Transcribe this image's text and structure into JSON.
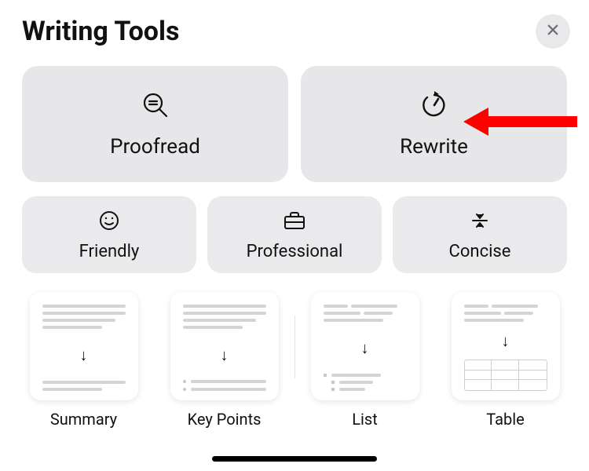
{
  "header": {
    "title": "Writing Tools"
  },
  "primary": [
    {
      "id": "proofread",
      "label": "Proofread",
      "icon": "magnify-equal-icon"
    },
    {
      "id": "rewrite",
      "label": "Rewrite",
      "icon": "rewrite-cycle-icon"
    }
  ],
  "secondary": [
    {
      "id": "friendly",
      "label": "Friendly",
      "icon": "smile-icon"
    },
    {
      "id": "professional",
      "label": "Professional",
      "icon": "briefcase-icon"
    },
    {
      "id": "concise",
      "label": "Concise",
      "icon": "collapse-icon"
    }
  ],
  "cards": [
    {
      "id": "summary",
      "label": "Summary"
    },
    {
      "id": "keypoints",
      "label": "Key Points"
    },
    {
      "id": "list",
      "label": "List"
    },
    {
      "id": "table",
      "label": "Table"
    }
  ],
  "annotation": {
    "type": "arrow",
    "color": "#ff0000",
    "points_to": "rewrite"
  }
}
